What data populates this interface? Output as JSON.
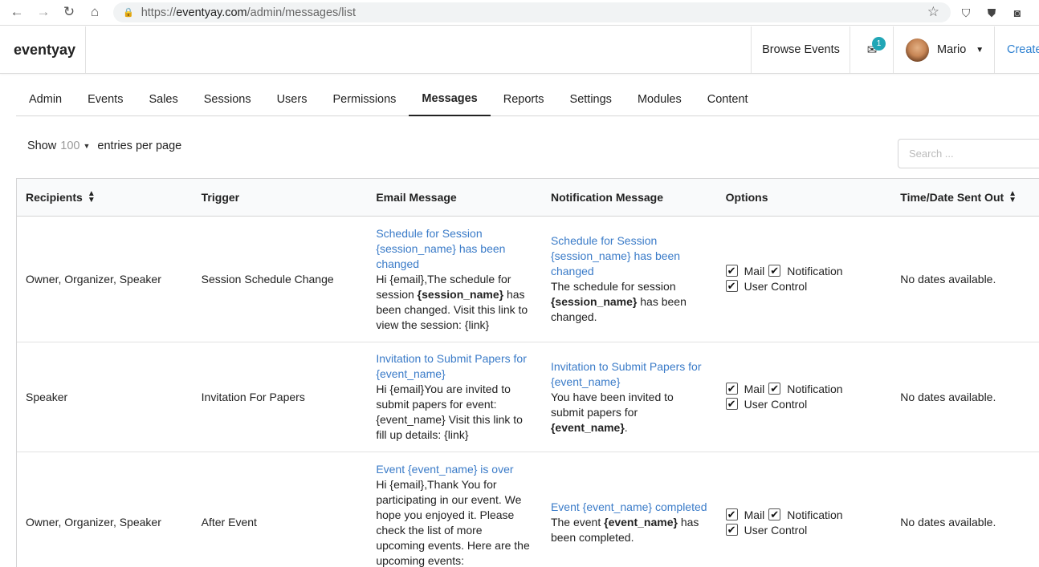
{
  "browser": {
    "url_prefix": "https://",
    "url_host": "eventyay.com",
    "url_path": "/admin/messages/list"
  },
  "header": {
    "brand": "eventyay",
    "browse_events": "Browse Events",
    "notification_count": "1",
    "user_name": "Mario",
    "create": "Create"
  },
  "tabs": [
    "Admin",
    "Events",
    "Sales",
    "Sessions",
    "Users",
    "Permissions",
    "Messages",
    "Reports",
    "Settings",
    "Modules",
    "Content"
  ],
  "controls": {
    "show_label": "Show",
    "show_value": "100",
    "entries_label": "entries per page",
    "search_placeholder": "Search ..."
  },
  "table": {
    "columns": [
      "Recipients",
      "Trigger",
      "Email Message",
      "Notification Message",
      "Options",
      "Time/Date Sent Out"
    ],
    "options_labels": {
      "mail": "Mail",
      "notification": "Notification",
      "user_control": "User Control"
    },
    "rows": [
      {
        "recipients": "Owner, Organizer, Speaker",
        "trigger": "Session Schedule Change",
        "email_subject": "Schedule for Session {session_name} has been changed",
        "email_pre": "Hi {email},The schedule for session ",
        "email_bold": "{session_name}",
        "email_post": " has been changed. Visit this link to view the session: {link}",
        "notif_subject": "Schedule for Session {session_name} has been changed",
        "notif_pre": "The schedule for session ",
        "notif_bold": "{session_name}",
        "notif_post": " has been changed.",
        "sent": "No dates available."
      },
      {
        "recipients": "Speaker",
        "trigger": "Invitation For Papers",
        "email_subject": "Invitation to Submit Papers for {event_name}",
        "email_pre": "Hi {email}You are invited to submit papers for event: {event_name} Visit this link to fill up details: {link}",
        "email_bold": "",
        "email_post": "",
        "notif_subject": "Invitation to Submit Papers for {event_name}",
        "notif_pre": "You have been invited to submit papers for ",
        "notif_bold": "{event_name}",
        "notif_post": ".",
        "sent": "No dates available."
      },
      {
        "recipients": "Owner, Organizer, Speaker",
        "trigger": "After Event",
        "email_subject": "Event {event_name} is over",
        "email_pre": "Hi {email},Thank You for participating in our event. We hope you enjoyed it. Please check the list of more upcoming events. Here are the upcoming events: {upcoming_events}. Get",
        "email_bold": "",
        "email_post": "",
        "notif_subject": "Event {event_name} completed",
        "notif_pre": "The event ",
        "notif_bold": "{event_name}",
        "notif_post": " has been completed.",
        "sent": "No dates available."
      }
    ]
  }
}
